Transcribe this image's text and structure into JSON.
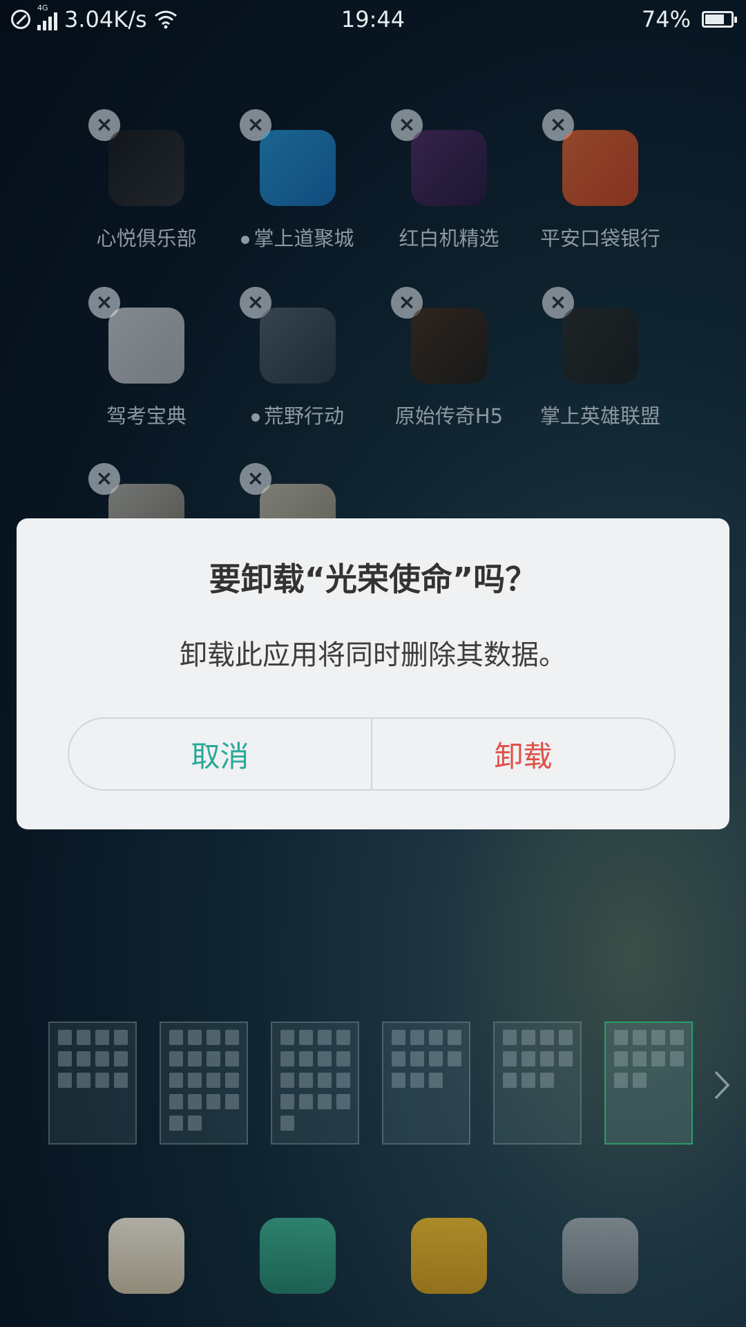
{
  "status_bar": {
    "network_type": "4G",
    "speed": "3.04K/s",
    "time": "19:44",
    "battery_percent": "74%",
    "battery_level": 0.74
  },
  "apps": [
    {
      "label": "心悦俱乐部",
      "icon": "xinyue-club-icon",
      "has_dot": false
    },
    {
      "label": "掌上道聚城",
      "icon": "daojucheng-icon",
      "has_dot": true
    },
    {
      "label": "红白机精选",
      "icon": "famicom-select-icon",
      "has_dot": false
    },
    {
      "label": "平安口袋银行",
      "icon": "pingan-bank-icon",
      "has_dot": false
    },
    {
      "label": "驾考宝典",
      "icon": "driving-test-icon",
      "has_dot": false
    },
    {
      "label": "荒野行动",
      "icon": "knives-out-icon",
      "has_dot": true
    },
    {
      "label": "原始传奇H5",
      "icon": "legend-h5-icon",
      "has_dot": false
    },
    {
      "label": "掌上英雄联盟",
      "icon": "lol-helper-icon",
      "has_dot": false
    },
    {
      "label": "",
      "icon": "game-soldier-icon",
      "has_dot": false
    },
    {
      "label": "",
      "icon": "call-of-duty-icon",
      "has_dot": false
    }
  ],
  "dialog": {
    "title": "要卸载“光荣使命”吗？",
    "message": "卸载此应用将同时删除其数据。",
    "cancel_label": "取消",
    "confirm_label": "卸载",
    "cancel_color": "#2aa898",
    "confirm_color": "#e0504a"
  },
  "pages": {
    "counts": [
      12,
      18,
      17,
      11,
      11,
      10
    ],
    "active_index": 5
  },
  "dock": [
    "camera-icon",
    "phone-icon",
    "messages-icon",
    "settings-icon"
  ]
}
